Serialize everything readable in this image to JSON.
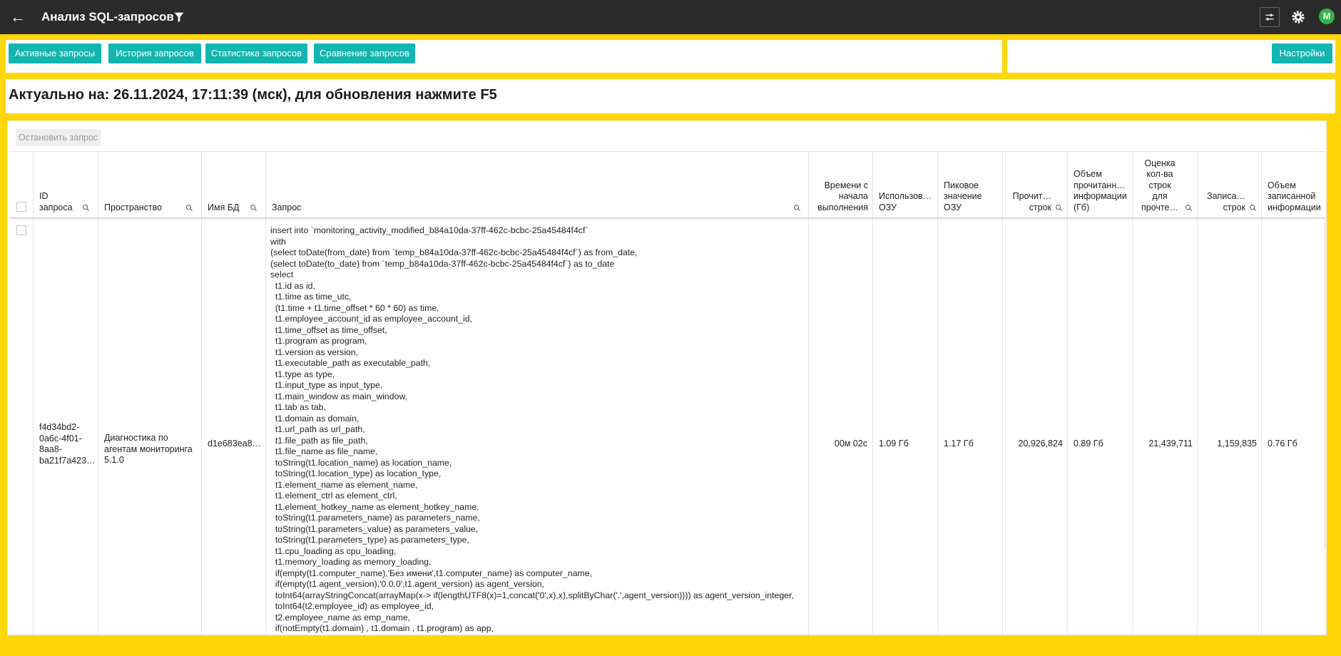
{
  "topbar": {
    "title": "Анализ SQL-запросов",
    "back_icon": "arrow-left-icon",
    "filter_icon": "filter-icon",
    "tune_icon": "tune-icon",
    "settings_icon": "gear-icon",
    "avatar": "M"
  },
  "tabs": [
    "Активные запросы",
    "История запросов",
    "Статистика запросов",
    "Сравнение запросов"
  ],
  "settings_button": "Настройки",
  "status": "Актуально на: 26.11.2024, 17:11:39 (мск), для обновления нажмите F5",
  "stop_button": "Остановить запрос",
  "columns": [
    {
      "label": "ID\nзапроса",
      "search": true
    },
    {
      "label": "Пространство",
      "search": true
    },
    {
      "label": "Имя БД",
      "search": true
    },
    {
      "label": "Запрос",
      "search": true
    },
    {
      "label": "Времени с\nначала\nвыполнения",
      "search": false
    },
    {
      "label": "Использов…\nОЗУ",
      "search": false
    },
    {
      "label": "Пиковое\nзначение\nОЗУ",
      "search": false
    },
    {
      "label": "Прочит…\nстрок",
      "search": true
    },
    {
      "label": "Объем\nпрочитанн…\nинформации\n(Гб)",
      "search": false
    },
    {
      "label": "Оценка\nкол-ва\nстрок\nдля\nпрочте…",
      "search": true
    },
    {
      "label": "Записа…\nстрок",
      "search": true
    },
    {
      "label": "Объем\nзаписанной\nинформации",
      "search": false
    }
  ],
  "row": {
    "id": "f4d34bd2-\n0a6c-4f01-\n8aa8-\nba21f7a423…",
    "space": "Диагностика по\nагентам мониторинга\n5.1.0",
    "db": "d1e683ea8…",
    "elapsed": "00м 02с",
    "mem_used": "1.09 Гб",
    "mem_peak": "1.17 Гб",
    "rows_read": "20,926,824",
    "bytes_read": "0.89 Гб",
    "rows_estimate": "21,439,711",
    "rows_written": "1,159,835",
    "bytes_written": "0.76 Гб",
    "query": "insert into `monitoring_activity_modified_b84a10da-37ff-462c-bcbc-25a45484f4cf`\nwith\n(select toDate(from_date) from `temp_b84a10da-37ff-462c-bcbc-25a45484f4cf`) as from_date,\n(select toDate(to_date) from `temp_b84a10da-37ff-462c-bcbc-25a45484f4cf`) as to_date\nselect\n  t1.id as id,\n  t1.time as time_utc,\n  (t1.time + t1.time_offset * 60 * 60) as time,\n  t1.employee_account_id as employee_account_id,\n  t1.time_offset as time_offset,\n  t1.program as program,\n  t1.version as version,\n  t1.executable_path as executable_path,\n  t1.type as type,\n  t1.input_type as input_type,\n  t1.main_window as main_window,\n  t1.tab as tab,\n  t1.domain as domain,\n  t1.url_path as url_path,\n  t1.file_path as file_path,\n  t1.file_name as file_name,\n  toString(t1.location_name) as location_name,\n  toString(t1.location_type) as location_type,\n  t1.element_name as element_name,\n  t1.element_ctrl as element_ctrl,\n  t1.element_hotkey_name as element_hotkey_name,\n  toString(t1.parameters_name) as parameters_name,\n  toString(t1.parameters_value) as parameters_value,\n  toString(t1.parameters_type) as parameters_type,\n  t1.cpu_loading as cpu_loading,\n  t1.memory_loading as memory_loading,\n  if(empty(t1.computer_name),'Без имени',t1.computer_name) as computer_name,\n  if(empty(t1.agent_version),'0.0.0',t1.agent_version) as agent_version,\n  toInt64(arrayStringConcat(arrayMap(x-> if(lengthUTF8(x)=1,concat('0',x),x),splitByChar('.',agent_version)))) as agent_version_integer,\n  toInt64(t2.employee_id) as employee_id,\n  t2.employee_name as emp_name,\n  if(notEmpty(t1.domain) , t1.domain , t1.program) as app,"
  }
}
